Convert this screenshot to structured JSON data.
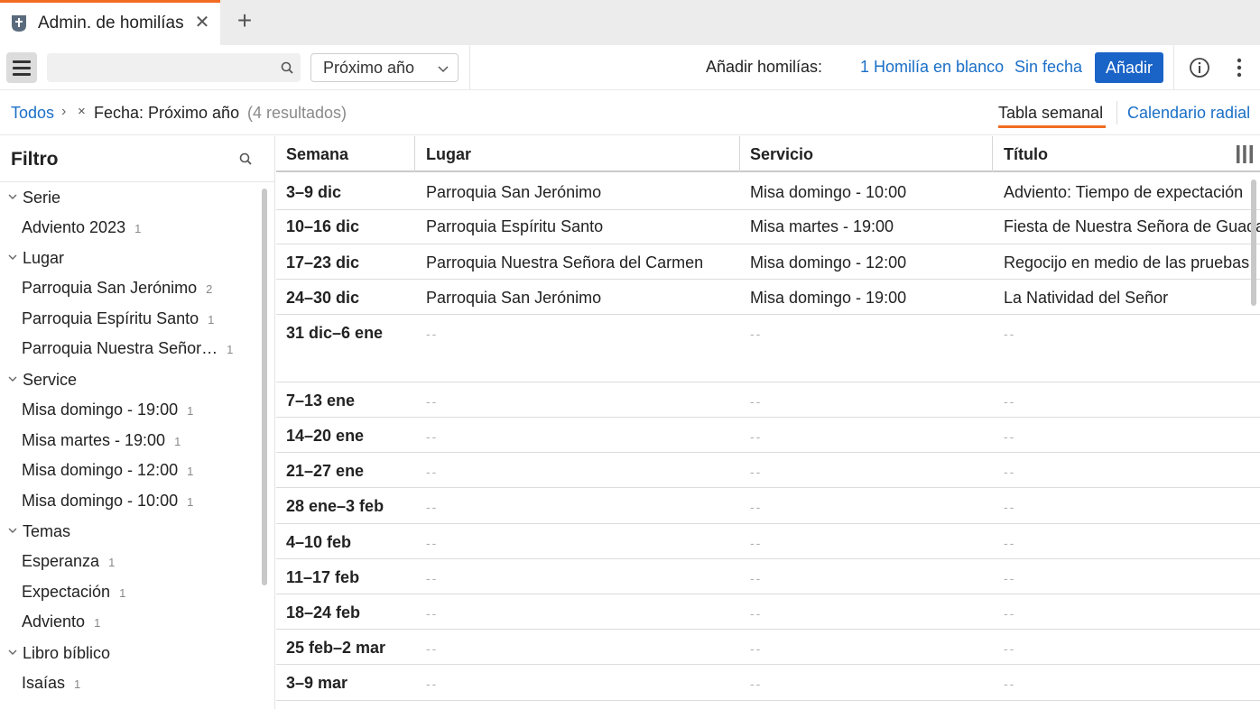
{
  "tab": {
    "title": "Admin. de homilías",
    "close": "✕",
    "new": "+"
  },
  "toolbar": {
    "search_placeholder": "",
    "period_select": "Próximo año",
    "add_label": "Añadir homilías:",
    "blank_link": "1 Homilía en blanco",
    "nodate_link": "Sin fecha",
    "add_button": "Añadir"
  },
  "breadcrumb": {
    "all": "Todos",
    "sep": "›",
    "remove": "×",
    "filter": "Fecha: Próximo año",
    "count": "(4 resultados)"
  },
  "views": {
    "weekly": "Tabla semanal",
    "radial": "Calendario radial"
  },
  "sidebar": {
    "title": "Filtro",
    "groups": [
      {
        "label": "Serie",
        "items": [
          {
            "label": "Adviento 2023",
            "count": "1"
          }
        ]
      },
      {
        "label": "Lugar",
        "items": [
          {
            "label": "Parroquia San Jerónimo",
            "count": "2"
          },
          {
            "label": "Parroquia Espíritu Santo",
            "count": "1"
          },
          {
            "label": "Parroquia Nuestra Señor…",
            "count": "1"
          }
        ]
      },
      {
        "label": "Service",
        "items": [
          {
            "label": "Misa domingo - 19:00",
            "count": "1"
          },
          {
            "label": "Misa martes - 19:00",
            "count": "1"
          },
          {
            "label": "Misa domingo - 12:00",
            "count": "1"
          },
          {
            "label": "Misa domingo - 10:00",
            "count": "1"
          }
        ]
      },
      {
        "label": "Temas",
        "items": [
          {
            "label": "Esperanza",
            "count": "1"
          },
          {
            "label": "Expectación",
            "count": "1"
          },
          {
            "label": "Adviento",
            "count": "1"
          }
        ]
      },
      {
        "label": "Libro bíblico",
        "items": [
          {
            "label": "Isaías",
            "count": "1"
          }
        ]
      }
    ]
  },
  "table": {
    "headers": [
      "Semana",
      "Lugar",
      "Servicio",
      "Título"
    ],
    "empty": "--",
    "rows": [
      {
        "week": "3–9 dic",
        "place": "Parroquia San Jerónimo",
        "service": "Misa domingo - 10:00",
        "title": "Adviento: Tiempo de expectación"
      },
      {
        "week": "10–16 dic",
        "place": "Parroquia Espíritu Santo",
        "service": "Misa martes - 19:00",
        "title": "Fiesta de Nuestra Señora de Guadalupe"
      },
      {
        "week": "17–23 dic",
        "place": "Parroquia Nuestra Señora del Carmen",
        "service": "Misa domingo - 12:00",
        "title": "Regocijo en medio de las pruebas"
      },
      {
        "week": "24–30 dic",
        "place": "Parroquia San Jerónimo",
        "service": "Misa domingo - 19:00",
        "title": "La Natividad del Señor"
      },
      {
        "week": "31 dic–6 ene",
        "place": "",
        "service": "",
        "title": ""
      },
      {
        "week": "7–13 ene",
        "place": "",
        "service": "",
        "title": ""
      },
      {
        "week": "14–20 ene",
        "place": "",
        "service": "",
        "title": ""
      },
      {
        "week": "21–27 ene",
        "place": "",
        "service": "",
        "title": ""
      },
      {
        "week": "28 ene–3 feb",
        "place": "",
        "service": "",
        "title": ""
      },
      {
        "week": "4–10 feb",
        "place": "",
        "service": "",
        "title": ""
      },
      {
        "week": "11–17 feb",
        "place": "",
        "service": "",
        "title": ""
      },
      {
        "week": "18–24 feb",
        "place": "",
        "service": "",
        "title": ""
      },
      {
        "week": "25 feb–2 mar",
        "place": "",
        "service": "",
        "title": ""
      },
      {
        "week": "3–9 mar",
        "place": "",
        "service": "",
        "title": ""
      }
    ]
  },
  "colors": {
    "accent": "#f26b21",
    "link": "#1a6fc7",
    "button": "#1a63c7"
  },
  "icons": [
    "tab-app-icon",
    "close-icon",
    "plus-icon",
    "menu-icon",
    "search-icon",
    "chevron-down-icon",
    "info-icon",
    "more-vertical-icon",
    "columns-icon"
  ]
}
